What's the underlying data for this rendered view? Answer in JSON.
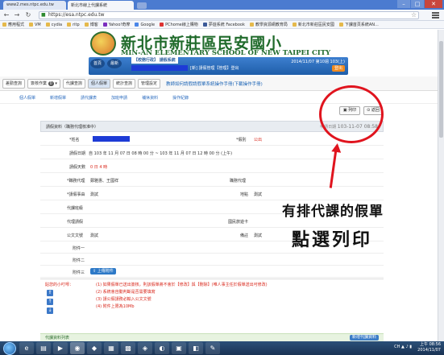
{
  "browser": {
    "tabs": [
      "www2.mes.ntpc.edu.tw",
      "新北市線上代課系統"
    ],
    "url": "https://esa.ntpc.edu.tw",
    "bookmarks": [
      "應用程式",
      "VM",
      "cydia",
      "ritp",
      "博客",
      "Yahoo!奇摩",
      "Google",
      "PChome線上購物",
      "夢遊系統 Facebook",
      "教學資源網教育局",
      "新北市新莊區民安國",
      "下課首頁系統AN..."
    ]
  },
  "header": {
    "title_zh": "新北市新莊區民安國小",
    "title_en": "MIN-AN ELEMENTARY SCHOOL OF NEW TAIPEI CITY",
    "home_btn": "首頁",
    "news_btn": "最新",
    "system_name": "【校務行政】 請假系統",
    "user_line": "[新] 請假管理【管理】登出",
    "semester": "2014/11/07 第10週 103(上)",
    "login_btn": "登出"
  },
  "menu": {
    "items": [
      "差勤查詢",
      "簽核作業",
      "代課查詢",
      "個人假單",
      "統計查詢",
      "管理設定"
    ],
    "notification_count": "0",
    "link": "教師如何請假請假單系統操作手冊(下載操作手冊)"
  },
  "breadcrumbs": [
    "個人假單",
    "新增假單",
    "請代課表",
    "加班申請",
    "補休資料",
    "操作紀錄"
  ],
  "actions": {
    "print": "列印",
    "back": "返回"
  },
  "form": {
    "title": "請假資料（職務代理核准中）",
    "status_label": "申請日期",
    "status_date": "103-11-07 08:58",
    "name_label": "*姓名",
    "type_label": "*假別",
    "type_value": "公出",
    "date_label": "請假日期",
    "date_value": "自 103 年 11 月 07 日 08 時 00 分 ~ 103 年 11 月 07 日 12 時 00 分 (上午)",
    "days_label": "請假天數",
    "days_value": "0 日 4 時",
    "agent_label": "*職務代理",
    "agent_value": "鄭雅惠、王國祥",
    "proxy_label": "職務代理",
    "reason_label": "*請假事由",
    "reason_value": "測試",
    "location_label": "地點",
    "location_value": "測試",
    "sub_class_label": "代課班級",
    "sub_reason_label": "代理請假",
    "trip_label": "國民旅遊卡",
    "doc_label": "公文文號",
    "doc_value": "測試",
    "remark_label": "備註",
    "remark_value": "測試",
    "attach1_label": "附件一",
    "attach2_label": "附件二",
    "attach3_label": "附件三",
    "upload_btn": "上傳附件"
  },
  "notes": {
    "heading": "貼您的小叮嚀：",
    "items": [
      "(1) 如果假單已送出簽核，則該假單將不會於【修改】與【刪除】(唯人事主任於假單送出可修改)",
      "(2) 系統會自動判斷是否需要填寫",
      "(3) 請公假請務必輸入公文文號",
      "(4) 附件上限為10Mb"
    ]
  },
  "sub_list": {
    "title": "代課資料列表",
    "button": "新增代課資料"
  },
  "annotation": {
    "line1": "有排代課的假單",
    "line2": "點選列印"
  },
  "taskbar": {
    "time": "上午 08:56",
    "date": "2014/11/07",
    "lang": "CH"
  }
}
